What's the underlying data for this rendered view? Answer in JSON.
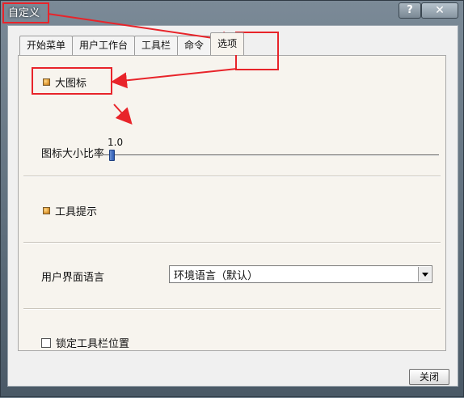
{
  "window": {
    "title": "自定义",
    "help_label": "?",
    "close_label": "✕"
  },
  "tabs": [
    {
      "label": "开始菜单",
      "active": false
    },
    {
      "label": "用户工作台",
      "active": false
    },
    {
      "label": "工具栏",
      "active": false
    },
    {
      "label": "命令",
      "active": false
    },
    {
      "label": "选项",
      "active": true
    }
  ],
  "options": {
    "large_icons": {
      "label": "大图标",
      "checked": true,
      "icon": "led-indicator-icon"
    },
    "icon_ratio": {
      "label": "图标大小比率",
      "value": "1.0"
    },
    "tooltips": {
      "label": "工具提示",
      "checked": true,
      "icon": "led-indicator-icon"
    },
    "ui_language": {
      "label": "用户界面语言",
      "selected": "环境语言（默认）"
    },
    "lock_toolbar": {
      "label": "锁定工具栏位置",
      "checked": false
    }
  },
  "footer": {
    "close_label": "关闭"
  },
  "colors": {
    "annotation_red": "#e8242a",
    "led_on": "#e09a34"
  }
}
